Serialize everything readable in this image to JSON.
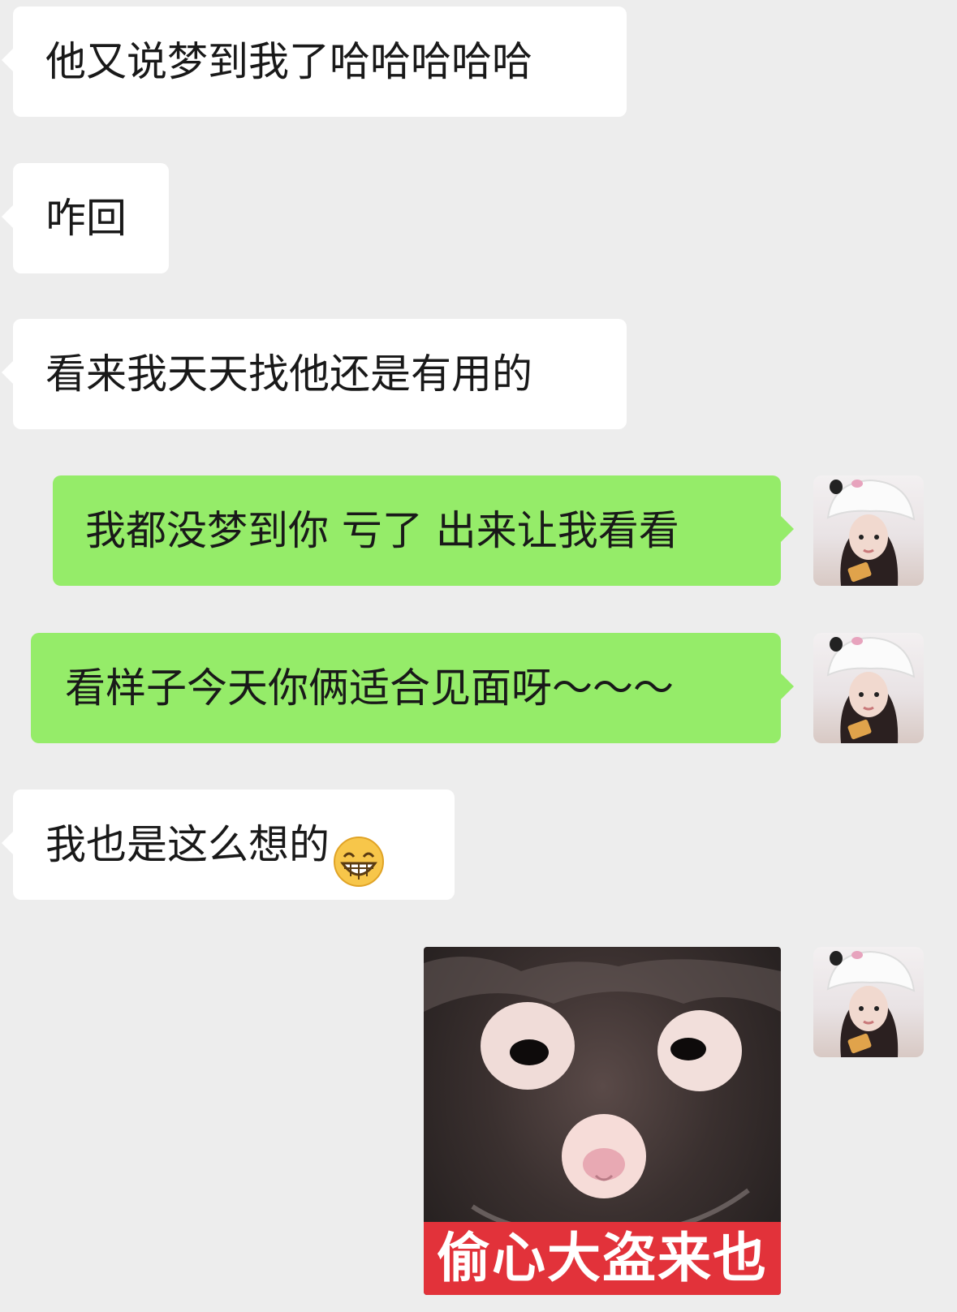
{
  "chat": {
    "messages": [
      {
        "side": "in",
        "text": "他又说梦到我了哈哈哈哈哈"
      },
      {
        "side": "in",
        "text": "咋回"
      },
      {
        "side": "in",
        "text": "看来我天天找他还是有用的"
      },
      {
        "side": "out",
        "text": "我都没梦到你 亏了 出来让我看看"
      },
      {
        "side": "out",
        "text": "看样子今天你俩适合见面呀～～～"
      },
      {
        "side": "in",
        "text": "我也是这么想的",
        "emoji": "grinning-face-icon"
      },
      {
        "side": "out",
        "sticker": "masked-cat-sticker",
        "caption": "偷心大盗来也"
      }
    ]
  },
  "colors": {
    "background": "#ededed",
    "incoming_bubble": "#ffffff",
    "outgoing_bubble": "#95ec69",
    "sticker_caption_bg": "#e2323a"
  }
}
